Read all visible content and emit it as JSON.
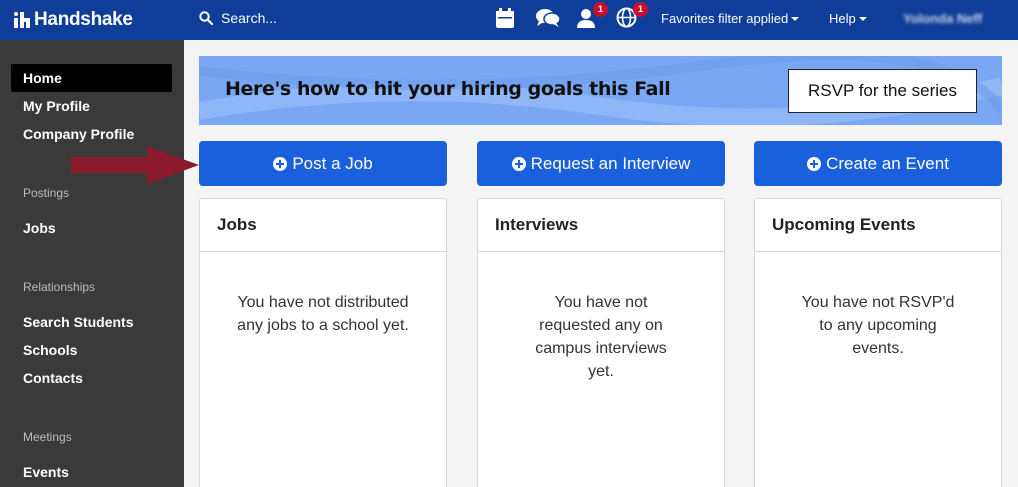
{
  "header": {
    "brand": "Handshake",
    "search_label": "Search...",
    "notification_count": "1",
    "globe_count": "1",
    "favorites_label": "Favorites filter applied",
    "help_label": "Help",
    "user_name": "Yolonda Neff",
    "brand_color": "#0e3d9a",
    "badge_color": "#c8102e"
  },
  "sidebar": {
    "home": "Home",
    "my_profile": "My Profile",
    "company_profile": "Company Profile",
    "postings_heading": "Postings",
    "jobs": "Jobs",
    "relationships_heading": "Relationships",
    "search_students": "Search Students",
    "schools": "Schools",
    "contacts": "Contacts",
    "meetings_heading": "Meetings",
    "events": "Events"
  },
  "banner": {
    "title": "Here's how to hit your hiring goals this Fall",
    "rsvp_label": "RSVP for the series",
    "color": "#7aa7f3"
  },
  "actions": {
    "post_job": "Post a Job",
    "request_interview": "Request an Interview",
    "create_event": "Create an Event",
    "button_color": "#1a5fdb"
  },
  "cards": {
    "jobs": {
      "title": "Jobs",
      "empty_text": "You have not distributed any jobs to a school yet."
    },
    "interviews": {
      "title": "Interviews",
      "empty_text": "You have not requested any on campus interviews yet."
    },
    "events": {
      "title": "Upcoming Events",
      "empty_text": "You have not RSVP'd to any upcoming events."
    }
  },
  "annotation": {
    "arrow_color": "#8b1a2b",
    "points_to": "post-job-button"
  }
}
